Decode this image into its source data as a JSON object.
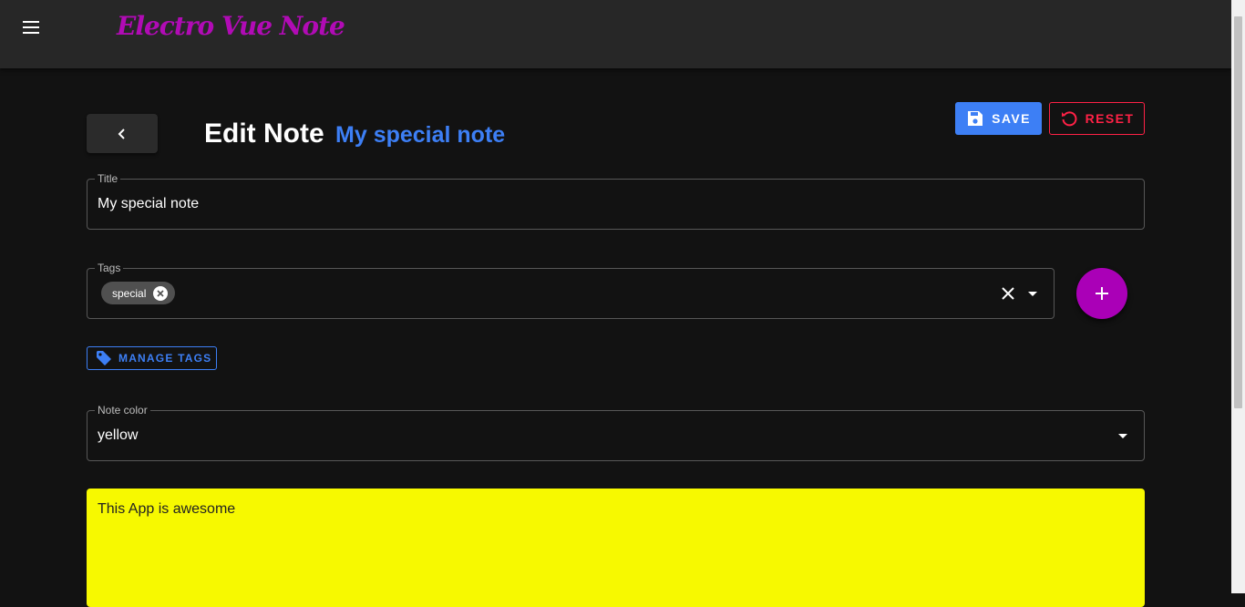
{
  "app": {
    "title": "Electro Vue Note"
  },
  "header": {
    "title": "Edit Note",
    "subtitle": "My special note"
  },
  "toolbar": {
    "save_label": "SAVE",
    "reset_label": "RESET"
  },
  "form": {
    "title_field": {
      "label": "Title",
      "value": "My special note"
    },
    "tags_field": {
      "label": "Tags",
      "chips": [
        "special"
      ]
    },
    "manage_tags_label": "MANAGE TAGS",
    "color_field": {
      "label": "Note color",
      "value": "yellow"
    },
    "content": "This App is awesome"
  },
  "colors": {
    "accent_blue": "#3d7ff5",
    "reset_red": "#ff2146",
    "brand_purple": "#aa00b7",
    "note_yellow": "#f7f900"
  },
  "icons": [
    "menu-icon",
    "chevron-left-icon",
    "floppy-disk-icon",
    "reset-icon",
    "close-circle-icon",
    "close-icon",
    "dropdown-arrow-icon",
    "plus-icon",
    "tag-icon"
  ]
}
